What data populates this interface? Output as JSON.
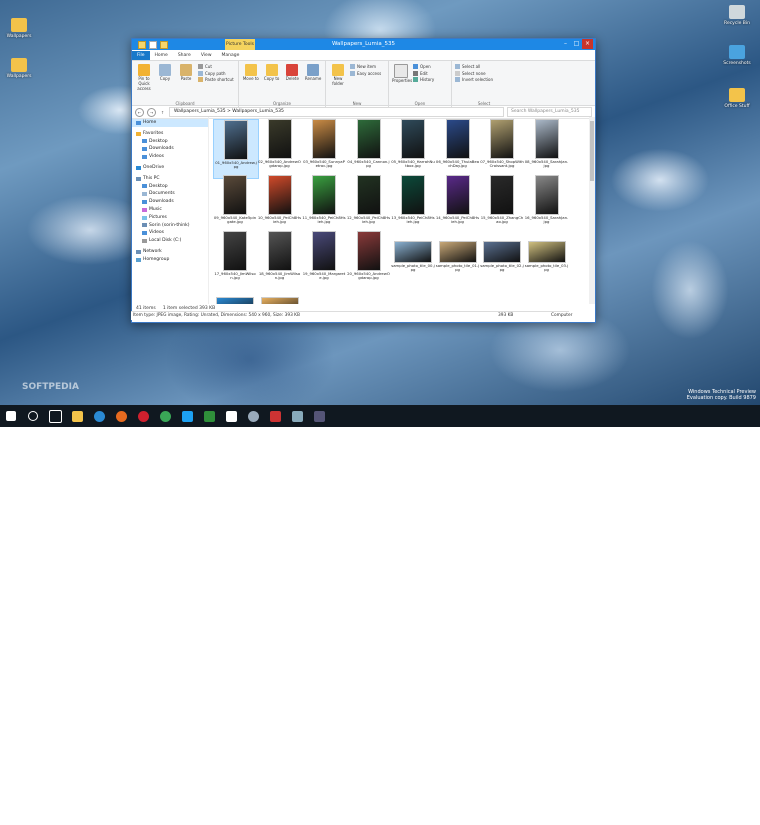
{
  "window": {
    "title": "Wallpapers_Lumia_535",
    "context_tab": "Picture Tools",
    "tabs": [
      "File",
      "Home",
      "Share",
      "View",
      "Manage"
    ]
  },
  "ribbon": {
    "clipboard": {
      "label": "Clipboard",
      "pin": "Pin to Quick access",
      "copy": "Copy",
      "paste": "Paste",
      "cut": "Cut",
      "copy_path": "Copy path",
      "paste_shortcut": "Paste shortcut"
    },
    "organize": {
      "label": "Organize",
      "move_to": "Move to",
      "copy_to": "Copy to",
      "delete": "Delete",
      "rename": "Rename"
    },
    "new": {
      "label": "New",
      "new_folder": "New folder",
      "new_item": "New item",
      "easy_access": "Easy access"
    },
    "open": {
      "label": "Open",
      "properties": "Properties",
      "open": "Open",
      "edit": "Edit",
      "history": "History"
    },
    "select": {
      "label": "Select",
      "select_all": "Select all",
      "select_none": "Select none",
      "invert": "Invert selection"
    }
  },
  "address": {
    "path": "Wallpapers_Lumia_535  >  Wallpapers_Lumia_535",
    "search_placeholder": "Search Wallpapers_Lumia_535"
  },
  "nav": [
    {
      "label": "Home",
      "sel": true
    },
    {
      "label": "Favorites"
    },
    {
      "label": "Desktop"
    },
    {
      "label": "Downloads"
    },
    {
      "label": "Videos"
    },
    {
      "label": "OneDrive"
    },
    {
      "label": "This PC"
    },
    {
      "label": "Desktop"
    },
    {
      "label": "Documents"
    },
    {
      "label": "Downloads"
    },
    {
      "label": "Music"
    },
    {
      "label": "Pictures"
    },
    {
      "label": "Sorin (sorin-think)"
    },
    {
      "label": "Videos"
    },
    {
      "label": "Local Disk (C:)"
    },
    {
      "label": "Network"
    },
    {
      "label": "Homegroup"
    }
  ],
  "files": [
    "01_960x540_Andrew.jpg",
    "02_960x540_AndrewOgdarop.jpg",
    "03_960x540_SunnyaPetroc.jpg",
    "04_960x540_Cannon.jpg",
    "05_960x540_HarrahNutbox.jpg",
    "06_960x540_ThulaBeachDay.jpg",
    "07_960x540_ShopWithCroissant.jpg",
    "08_960x540_SarahJan.jpg",
    "09_960x540_Kate5pingate.jpg",
    "10_960x540_PeiCh8Hsieh.jpg",
    "11_960x540_PeiCh8Hsieh.jpg",
    "12_960x540_PeiCh8Hsieh.jpg",
    "13_960x540_PeiCh8Hsieh.jpg",
    "14_960x540_PeiCh8Hsieh.jpg",
    "15_960x540_ZhangChao.jpg",
    "16_960x540_SarahJan.jpg",
    "17_960x540_JimWilson.jpg",
    "18_960x540_JimWilson.jpg",
    "19_960x540_Margarete.jpg",
    "20_960x540_AndrewOgdarop.jpg",
    "sample_photo_tile_00.jpg",
    "sample_photo_tile_01.jpg",
    "sample_photo_tile_02.jpg",
    "sample_photo_tile_03.jpg",
    "sample_photo_tile_04.jpg",
    "sample_photo_tile_05.jpg"
  ],
  "status": {
    "items": "41 items",
    "selected": "1 item selected  393 KB",
    "info": "Item type: JPEG image, Rating: Unrated, Dimensions: 540 x 960, Size: 393 KB",
    "size": "393 KB",
    "location": "Computer"
  },
  "desktop_icons": [
    "Wallpapers",
    "Wallpapers",
    "Recycle Bin",
    "Screenshots",
    "Office Stuff"
  ],
  "watermark": {
    "line1": "Windows Technical Preview",
    "line2": "Evaluation copy. Build 9879"
  },
  "clock": {
    "time": "12:28 PM",
    "date": "24-Nov-14"
  },
  "softpedia": "SOFTPEDIA"
}
